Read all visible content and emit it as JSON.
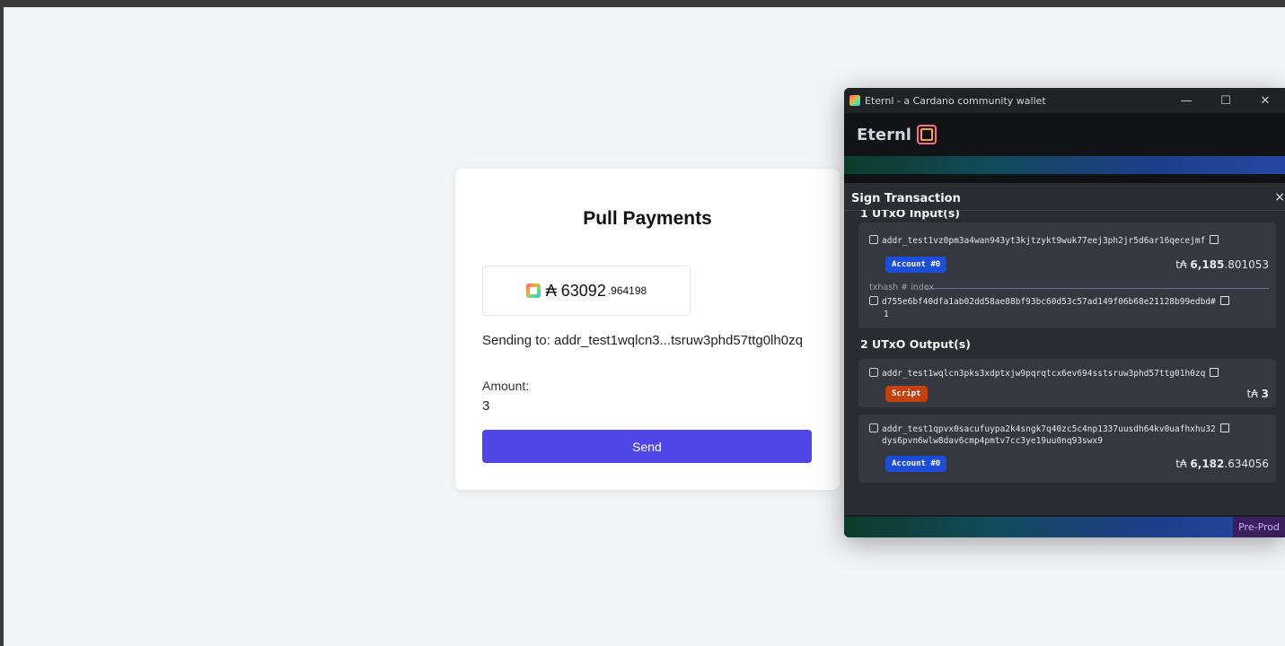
{
  "card": {
    "title": "Pull Payments",
    "balance_main": "₳ 63092",
    "balance_decimals": ".964198",
    "sending_to": "Sending to: addr_test1wqlcn3...tsruw3phd57ttg0lh0zq",
    "amount_label": "Amount:",
    "amount_value": "3",
    "send_label": "Send"
  },
  "wallet": {
    "window_title": "Eternl - a Cardano community wallet",
    "controls": {
      "minimize": "—",
      "maximize": "☐",
      "close": "✕"
    },
    "brand": "Eternl",
    "sign_title": "Sign Transaction",
    "close_glyph": "×",
    "inputs_heading": "1 UTxO Input(s)",
    "input": {
      "address": "addr_test1vz0pm3a4wan943yt3kjtzykt9wuk77eej3ph2jr5d6ar16qecejmf",
      "badge": "Account #0",
      "amount_prefix": "t₳ ",
      "amount_int": "6,185",
      "amount_dec": ".801053",
      "txhash_label": "txhash # index",
      "txhash": "d755e6bf40dfa1ab02dd58ae88bf93bc60d53c57ad149f06b68e21128b99edbd#",
      "index": "1"
    },
    "outputs_heading": "2 UTxO Output(s)",
    "outputs": [
      {
        "address": "addr_test1wqlcn3pks3xdptxjw9pqrqtcx6ev694sstsruw3phd57ttg01h0zq",
        "badge": "Script",
        "amount_prefix": "t₳ ",
        "amount_int": "3",
        "amount_dec": ""
      },
      {
        "address": "addr_test1qpvx0sacufuypa2k4sngk7q40zc5c4np1337uusdh64kv0uafhxhu32",
        "address_line2": "dys6pvn6wlw8dav6cmp4pmtv7cc3ye19uu0nq93swx9",
        "badge": "Account #0",
        "amount_prefix": "t₳ ",
        "amount_int": "6,182",
        "amount_dec": ".634056"
      }
    ],
    "network_badge": "Pre-Prod"
  }
}
